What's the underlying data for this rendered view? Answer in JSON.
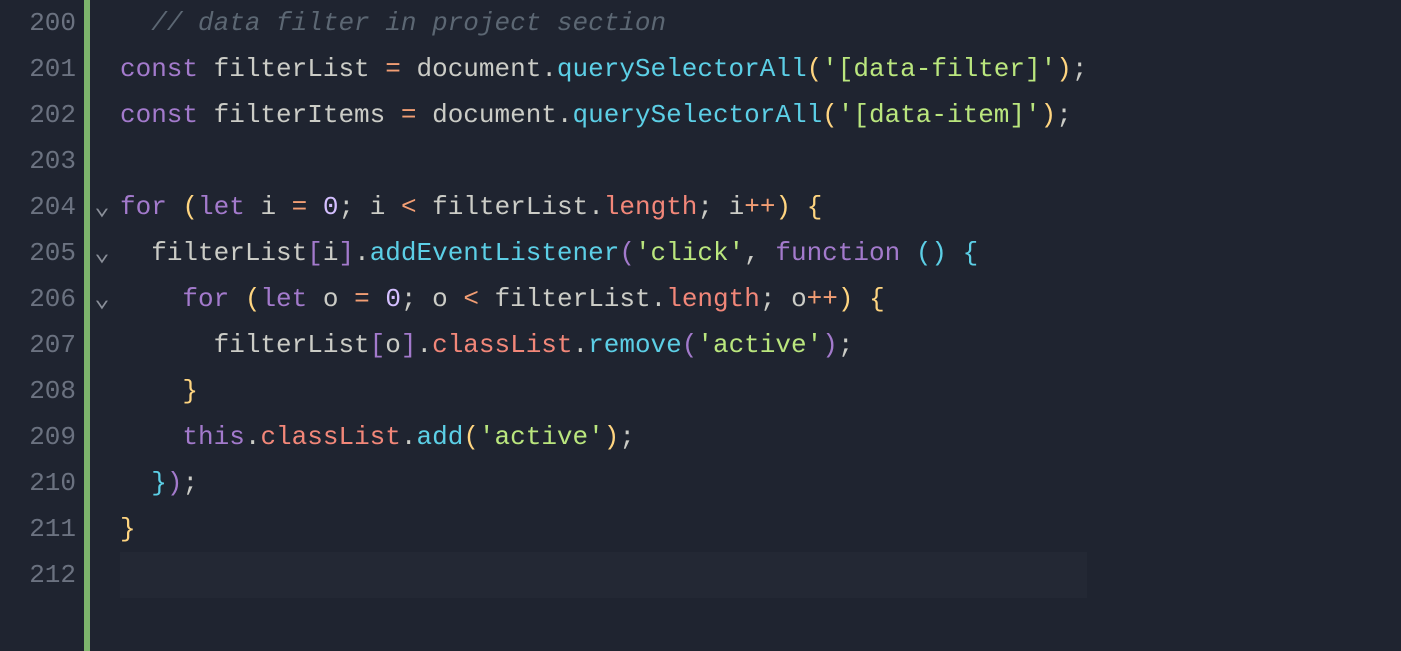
{
  "editor": {
    "startLine": 200,
    "endLine": 212,
    "foldMarkers": {
      "204": "v",
      "205": "v",
      "206": "v"
    },
    "lines": {
      "200": {
        "tokens": [
          {
            "cls": "",
            "t": "  "
          },
          {
            "cls": "c-comment",
            "t": "// data filter in project section"
          }
        ]
      },
      "201": {
        "tokens": [
          {
            "cls": "c-keyword",
            "t": "const"
          },
          {
            "cls": "",
            "t": " "
          },
          {
            "cls": "c-var",
            "t": "filterList"
          },
          {
            "cls": "",
            "t": " "
          },
          {
            "cls": "c-op",
            "t": "="
          },
          {
            "cls": "",
            "t": " "
          },
          {
            "cls": "c-ident",
            "t": "document"
          },
          {
            "cls": "c-dot",
            "t": "."
          },
          {
            "cls": "c-call",
            "t": "querySelectorAll"
          },
          {
            "cls": "c-brace",
            "t": "("
          },
          {
            "cls": "c-string",
            "t": "'[data-filter]'"
          },
          {
            "cls": "c-brace",
            "t": ")"
          },
          {
            "cls": "c-punc",
            "t": ";"
          }
        ]
      },
      "202": {
        "tokens": [
          {
            "cls": "c-keyword",
            "t": "const"
          },
          {
            "cls": "",
            "t": " "
          },
          {
            "cls": "c-var",
            "t": "filterItems"
          },
          {
            "cls": "",
            "t": " "
          },
          {
            "cls": "c-op",
            "t": "="
          },
          {
            "cls": "",
            "t": " "
          },
          {
            "cls": "c-ident",
            "t": "document"
          },
          {
            "cls": "c-dot",
            "t": "."
          },
          {
            "cls": "c-call",
            "t": "querySelectorAll"
          },
          {
            "cls": "c-brace",
            "t": "("
          },
          {
            "cls": "c-string",
            "t": "'[data-item]'"
          },
          {
            "cls": "c-brace",
            "t": ")"
          },
          {
            "cls": "c-punc",
            "t": ";"
          }
        ]
      },
      "203": {
        "tokens": [
          {
            "cls": "",
            "t": " "
          }
        ]
      },
      "204": {
        "tokens": [
          {
            "cls": "c-keyword",
            "t": "for"
          },
          {
            "cls": "",
            "t": " "
          },
          {
            "cls": "c-brace",
            "t": "("
          },
          {
            "cls": "c-keyword",
            "t": "let"
          },
          {
            "cls": "",
            "t": " "
          },
          {
            "cls": "c-var",
            "t": "i"
          },
          {
            "cls": "",
            "t": " "
          },
          {
            "cls": "c-op",
            "t": "="
          },
          {
            "cls": "",
            "t": " "
          },
          {
            "cls": "c-num",
            "t": "0"
          },
          {
            "cls": "c-punc",
            "t": ";"
          },
          {
            "cls": "",
            "t": " "
          },
          {
            "cls": "c-var",
            "t": "i"
          },
          {
            "cls": "",
            "t": " "
          },
          {
            "cls": "c-op",
            "t": "<"
          },
          {
            "cls": "",
            "t": " "
          },
          {
            "cls": "c-var",
            "t": "filterList"
          },
          {
            "cls": "c-dot",
            "t": "."
          },
          {
            "cls": "c-prop",
            "t": "length"
          },
          {
            "cls": "c-punc",
            "t": ";"
          },
          {
            "cls": "",
            "t": " "
          },
          {
            "cls": "c-var",
            "t": "i"
          },
          {
            "cls": "c-op",
            "t": "++"
          },
          {
            "cls": "c-brace",
            "t": ")"
          },
          {
            "cls": "",
            "t": " "
          },
          {
            "cls": "c-brace",
            "t": "{"
          }
        ]
      },
      "205": {
        "tokens": [
          {
            "cls": "indent-guide",
            "t": "  "
          },
          {
            "cls": "c-var",
            "t": "filterList"
          },
          {
            "cls": "c-brace2",
            "t": "["
          },
          {
            "cls": "c-var",
            "t": "i"
          },
          {
            "cls": "c-brace2",
            "t": "]"
          },
          {
            "cls": "c-dot",
            "t": "."
          },
          {
            "cls": "c-call",
            "t": "addEventListener"
          },
          {
            "cls": "c-brace2",
            "t": "("
          },
          {
            "cls": "c-string",
            "t": "'click'"
          },
          {
            "cls": "c-punc",
            "t": ","
          },
          {
            "cls": "",
            "t": " "
          },
          {
            "cls": "c-keyword",
            "t": "function"
          },
          {
            "cls": "",
            "t": " "
          },
          {
            "cls": "c-brace3",
            "t": "()"
          },
          {
            "cls": "",
            "t": " "
          },
          {
            "cls": "c-brace3",
            "t": "{"
          }
        ]
      },
      "206": {
        "tokens": [
          {
            "cls": "indent-guide",
            "t": "    "
          },
          {
            "cls": "c-keyword",
            "t": "for"
          },
          {
            "cls": "",
            "t": " "
          },
          {
            "cls": "c-brace",
            "t": "("
          },
          {
            "cls": "c-keyword",
            "t": "let"
          },
          {
            "cls": "",
            "t": " "
          },
          {
            "cls": "c-var",
            "t": "o"
          },
          {
            "cls": "",
            "t": " "
          },
          {
            "cls": "c-op",
            "t": "="
          },
          {
            "cls": "",
            "t": " "
          },
          {
            "cls": "c-num",
            "t": "0"
          },
          {
            "cls": "c-punc",
            "t": ";"
          },
          {
            "cls": "",
            "t": " "
          },
          {
            "cls": "c-var",
            "t": "o"
          },
          {
            "cls": "",
            "t": " "
          },
          {
            "cls": "c-op",
            "t": "<"
          },
          {
            "cls": "",
            "t": " "
          },
          {
            "cls": "c-var",
            "t": "filterList"
          },
          {
            "cls": "c-dot",
            "t": "."
          },
          {
            "cls": "c-prop",
            "t": "length"
          },
          {
            "cls": "c-punc",
            "t": ";"
          },
          {
            "cls": "",
            "t": " "
          },
          {
            "cls": "c-var",
            "t": "o"
          },
          {
            "cls": "c-op",
            "t": "++"
          },
          {
            "cls": "c-brace",
            "t": ")"
          },
          {
            "cls": "",
            "t": " "
          },
          {
            "cls": "c-brace",
            "t": "{"
          }
        ]
      },
      "207": {
        "tokens": [
          {
            "cls": "indent-guide",
            "t": "      "
          },
          {
            "cls": "c-var",
            "t": "filterList"
          },
          {
            "cls": "c-brace2",
            "t": "["
          },
          {
            "cls": "c-var",
            "t": "o"
          },
          {
            "cls": "c-brace2",
            "t": "]"
          },
          {
            "cls": "c-dot",
            "t": "."
          },
          {
            "cls": "c-prop",
            "t": "classList"
          },
          {
            "cls": "c-dot",
            "t": "."
          },
          {
            "cls": "c-call",
            "t": "remove"
          },
          {
            "cls": "c-brace2",
            "t": "("
          },
          {
            "cls": "c-string",
            "t": "'active'"
          },
          {
            "cls": "c-brace2",
            "t": ")"
          },
          {
            "cls": "c-punc",
            "t": ";"
          }
        ]
      },
      "208": {
        "tokens": [
          {
            "cls": "indent-guide",
            "t": "    "
          },
          {
            "cls": "c-brace",
            "t": "}"
          }
        ]
      },
      "209": {
        "tokens": [
          {
            "cls": "indent-guide",
            "t": "    "
          },
          {
            "cls": "c-keyword",
            "t": "this"
          },
          {
            "cls": "c-dot",
            "t": "."
          },
          {
            "cls": "c-prop",
            "t": "classList"
          },
          {
            "cls": "c-dot",
            "t": "."
          },
          {
            "cls": "c-call",
            "t": "add"
          },
          {
            "cls": "c-brace",
            "t": "("
          },
          {
            "cls": "c-string",
            "t": "'active'"
          },
          {
            "cls": "c-brace",
            "t": ")"
          },
          {
            "cls": "c-punc",
            "t": ";"
          }
        ]
      },
      "210": {
        "tokens": [
          {
            "cls": "indent-guide",
            "t": "  "
          },
          {
            "cls": "c-brace3",
            "t": "}"
          },
          {
            "cls": "c-brace2",
            "t": ")"
          },
          {
            "cls": "c-punc",
            "t": ";"
          }
        ]
      },
      "211": {
        "tokens": [
          {
            "cls": "c-brace",
            "t": "}"
          }
        ]
      },
      "212": {
        "tokens": [
          {
            "cls": "",
            "t": " "
          }
        ],
        "current": true
      }
    }
  }
}
